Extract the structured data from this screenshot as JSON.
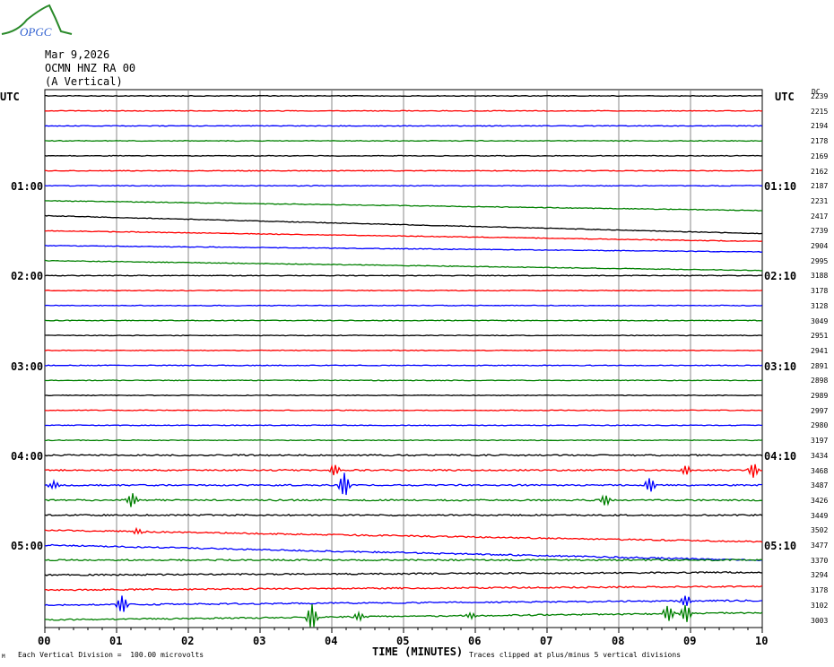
{
  "logo_text": "OPGC",
  "header": {
    "date": "Mar 9,2026",
    "station": "OCMN HNZ RA 00",
    "component": "(A Vertical)"
  },
  "dc_label": "DC",
  "chart_data": {
    "type": "line",
    "title": "Mar 9,2026 OCMN HNZ RA 00 (A Vertical)",
    "xlabel": "TIME (MINUTES)",
    "x_ticks": [
      "00",
      "01",
      "02",
      "03",
      "04",
      "05",
      "06",
      "07",
      "08",
      "09",
      "10"
    ],
    "xlim": [
      0,
      10
    ],
    "left_labels": [
      {
        "row": 0,
        "text": "UTC"
      },
      {
        "row": 6,
        "text": "01:00"
      },
      {
        "row": 12,
        "text": "02:00"
      },
      {
        "row": 18,
        "text": "03:00"
      },
      {
        "row": 24,
        "text": "04:00"
      },
      {
        "row": 30,
        "text": "05:00"
      }
    ],
    "right_labels": [
      {
        "row": 0,
        "text": "UTC"
      },
      {
        "row": 6,
        "text": "01:10"
      },
      {
        "row": 12,
        "text": "02:10"
      },
      {
        "row": 18,
        "text": "03:10"
      },
      {
        "row": 24,
        "text": "04:10"
      },
      {
        "row": 30,
        "text": "05:10"
      }
    ],
    "trace_colors": [
      "#000000",
      "#ff0000",
      "#0000ff",
      "#008000"
    ],
    "dc_offsets": [
      "2239",
      "2215",
      "2194",
      "2178",
      "2169",
      "2162",
      "2187",
      "2231",
      "2417",
      "2739",
      "2904",
      "2995",
      "3188",
      "3178",
      "3128",
      "3049",
      "2951",
      "2941",
      "2891",
      "2898",
      "2989",
      "2997",
      "2980",
      "3197",
      "3434",
      "3468",
      "3487",
      "3426",
      "3449",
      "3502",
      "3477",
      "3370",
      "3294",
      "3178",
      "3102",
      "3003"
    ],
    "footer_left": "Each Vertical Division =  100.00 microvolts",
    "footer_right": "Traces clipped at plus/minus 5 vertical divisions",
    "corner_mark": "M"
  }
}
